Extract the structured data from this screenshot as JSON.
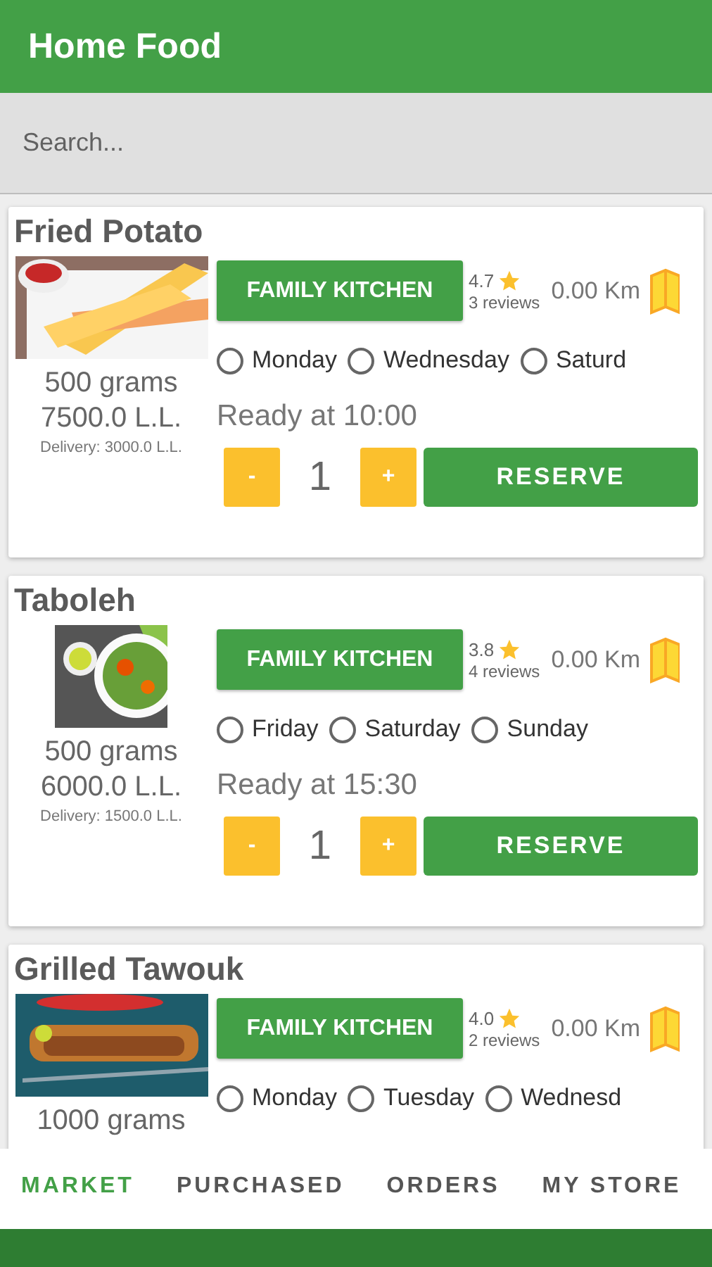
{
  "app_bar": {
    "title": "Home Food"
  },
  "search": {
    "placeholder": "Search..."
  },
  "items": [
    {
      "name": "Fried Potato",
      "weight": "500 grams",
      "price": "7500.0 L.L.",
      "delivery": "Delivery: 3000.0 L.L.",
      "seller": "FAMILY KITCHEN",
      "rating": "4.7",
      "reviews": "3 reviews",
      "distance": "0.00 Km",
      "days": [
        {
          "label": "Monday",
          "selected": false
        },
        {
          "label": "Wednesday",
          "selected": false
        },
        {
          "label": "Saturd",
          "selected": false
        }
      ],
      "ready": "Ready at 10:00",
      "minus": "-",
      "quantity": "1",
      "plus": "+",
      "reserve": "RESERVE"
    },
    {
      "name": "Taboleh",
      "weight": "500 grams",
      "price": "6000.0 L.L.",
      "delivery": "Delivery: 1500.0 L.L.",
      "seller": "FAMILY KITCHEN",
      "rating": "3.8",
      "reviews": "4 reviews",
      "distance": "0.00 Km",
      "days": [
        {
          "label": "Friday",
          "selected": false
        },
        {
          "label": "Saturday",
          "selected": false
        },
        {
          "label": "Sunday",
          "selected": false
        }
      ],
      "ready": "Ready at 15:30",
      "minus": "-",
      "quantity": "1",
      "plus": "+",
      "reserve": "RESERVE"
    },
    {
      "name": "Grilled Tawouk",
      "weight": "1000 grams",
      "seller": "FAMILY KITCHEN",
      "rating": "4.0",
      "reviews": "2 reviews",
      "distance": "0.00 Km",
      "days": [
        {
          "label": "Monday",
          "selected": false
        },
        {
          "label": "Tuesday",
          "selected": false
        },
        {
          "label": "Wednesd",
          "selected": false
        }
      ]
    }
  ],
  "tabs": [
    {
      "label": "MARKET",
      "selected": true
    },
    {
      "label": "PURCHASED",
      "selected": false
    },
    {
      "label": "ORDERS",
      "selected": false
    },
    {
      "label": "MY STORE",
      "selected": false
    }
  ]
}
